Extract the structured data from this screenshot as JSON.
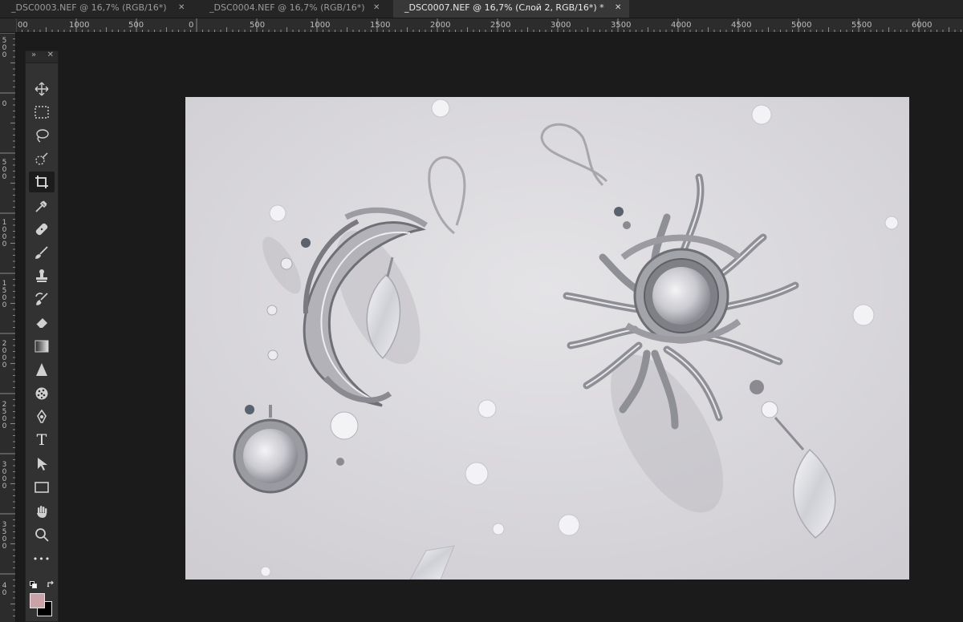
{
  "tabs": [
    {
      "label": "_DSC0003.NEF @ 16,7% (RGB/16*)",
      "close": "✕",
      "active": false
    },
    {
      "label": "_DSC0004.NEF @ 16,7% (RGB/16*)",
      "close": "✕",
      "active": false
    },
    {
      "label": "_DSC0007.NEF @ 16,7% (Слой 2, RGB/16*) *",
      "close": "✕",
      "active": true
    }
  ],
  "ruler_h": [
    "00",
    "1000",
    "500",
    "0",
    "500",
    "1000",
    "1500",
    "2000",
    "2500",
    "3000",
    "3500",
    "4000",
    "4500",
    "5000",
    "5500",
    "6000"
  ],
  "ruler_v": [
    "500",
    "0",
    "500",
    "1000",
    "1500",
    "2000",
    "2500",
    "3000",
    "3500",
    "40"
  ],
  "tools_panel": {
    "collapse_label": "»",
    "close_label": "✕",
    "tools": [
      {
        "name": "move-tool-icon",
        "selected": false
      },
      {
        "name": "marquee-tool-icon",
        "selected": false
      },
      {
        "name": "lasso-tool-icon",
        "selected": false
      },
      {
        "name": "quick-selection-tool-icon",
        "selected": false
      },
      {
        "name": "crop-tool-icon",
        "selected": true
      },
      {
        "name": "eyedropper-tool-icon",
        "selected": false
      },
      {
        "name": "healing-brush-tool-icon",
        "selected": false
      },
      {
        "name": "brush-tool-icon",
        "selected": false
      },
      {
        "name": "clone-stamp-tool-icon",
        "selected": false
      },
      {
        "name": "history-brush-tool-icon",
        "selected": false
      },
      {
        "name": "eraser-tool-icon",
        "selected": false
      },
      {
        "name": "gradient-tool-icon",
        "selected": false
      },
      {
        "name": "sharpen-tool-icon",
        "selected": false
      },
      {
        "name": "sponge-tool-icon",
        "selected": false
      },
      {
        "name": "pen-tool-icon",
        "selected": false
      },
      {
        "name": "type-tool-icon",
        "selected": false
      },
      {
        "name": "path-selection-tool-icon",
        "selected": false
      },
      {
        "name": "rectangle-tool-icon",
        "selected": false
      },
      {
        "name": "hand-tool-icon",
        "selected": false
      },
      {
        "name": "zoom-tool-icon",
        "selected": false
      },
      {
        "name": "more-tools-icon",
        "selected": false
      }
    ],
    "type_tool_glyph": "T",
    "more_tools_glyph": "•••",
    "foreground_color": "#c9a3a7",
    "background_color": "#000000"
  },
  "photo": {
    "subject": "silver wire-wrapped earrings: crescent moon and sun with druzy cabochons and crystal drops",
    "background_color": "#dadade"
  }
}
